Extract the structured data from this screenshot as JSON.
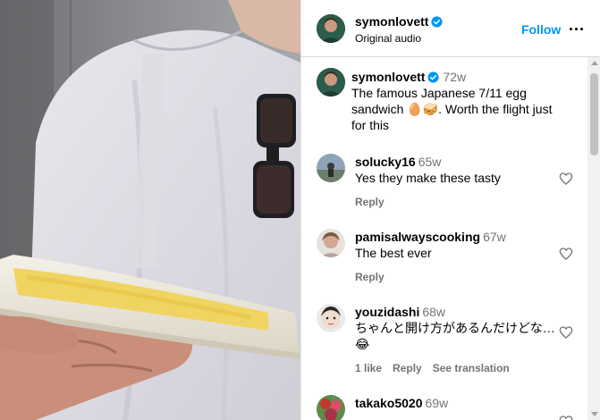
{
  "header": {
    "username": "symonlovett",
    "subtitle": "Original audio",
    "follow_label": "Follow"
  },
  "caption": {
    "username": "symonlovett",
    "time": "72w",
    "text": "The famous Japanese 7/11 egg sandwich 🥚🥪. Worth the flight just for this"
  },
  "comments": [
    {
      "username": "solucky16",
      "time": "65w",
      "text": "Yes they make these tasty",
      "actions": [
        "Reply"
      ]
    },
    {
      "username": "pamisalwayscooking",
      "time": "67w",
      "text": "The best ever",
      "actions": [
        "Reply"
      ]
    },
    {
      "username": "youzidashi",
      "time": "68w",
      "text": "ちゃんと開け方があるんだけどな…😂",
      "actions": [
        "1 like",
        "Reply",
        "See translation"
      ]
    },
    {
      "username": "takako5020",
      "time": "69w",
      "text": "",
      "actions": []
    }
  ],
  "colors": {
    "accent": "#0095f6",
    "verified": "#0095f6",
    "muted": "#737373"
  }
}
